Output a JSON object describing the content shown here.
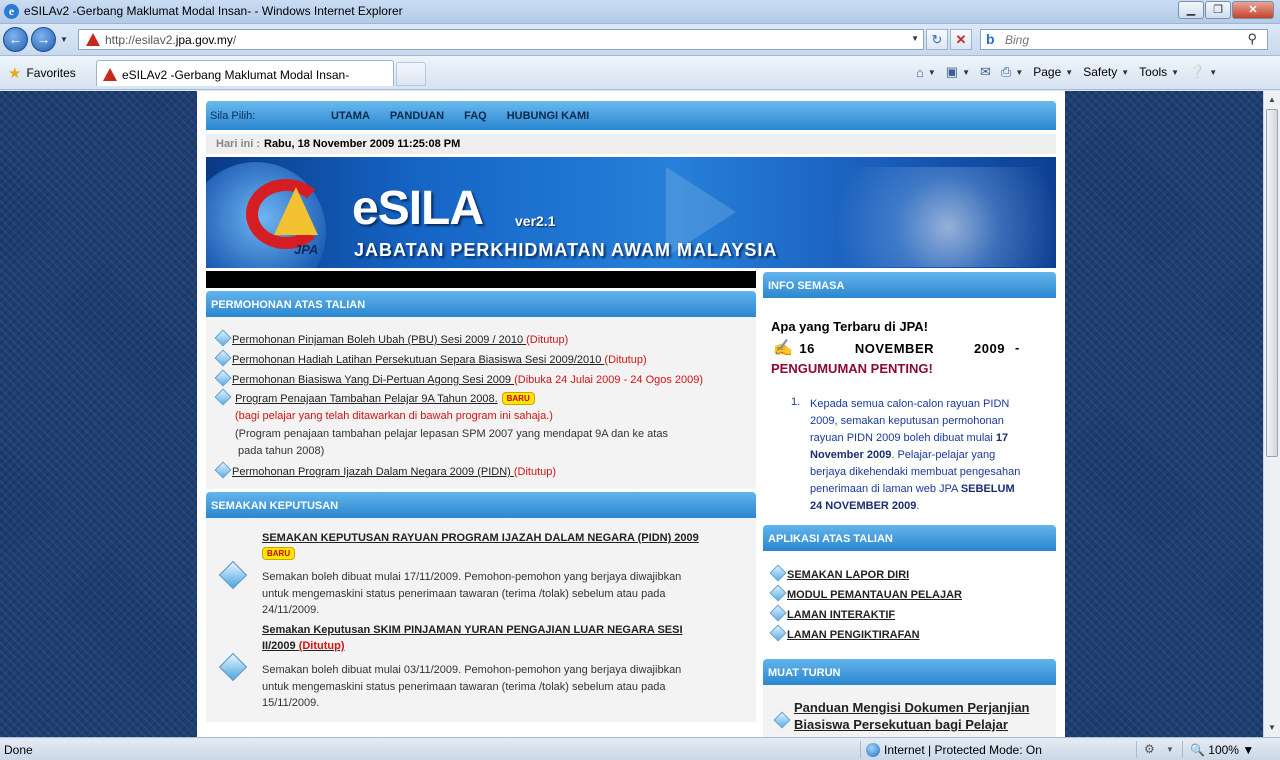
{
  "window": {
    "title": "eSILAv2 -Gerbang Maklumat Modal Insan- - Windows Internet Explorer",
    "minimize": "▁",
    "maximize": "❐",
    "close": "✕"
  },
  "address": {
    "url_prefix": "http://esilav2.",
    "url_domain": "jpa.gov.my",
    "url_suffix": "/",
    "search_placeholder": "Bing"
  },
  "favorites": {
    "label": "Favorites",
    "tab_title": "eSILAv2 -Gerbang Maklumat Modal Insan-",
    "commands": [
      "Page",
      "Safety",
      "Tools"
    ]
  },
  "site": {
    "menu_label": "Sila Pilih:",
    "menu_items": [
      "UTAMA",
      "PANDUAN",
      "FAQ",
      "HUBUNGI KAMI"
    ],
    "today_label": "Hari ini :",
    "today_value": "Rabu, 18 November 2009 11:25:08 PM",
    "banner": {
      "brand": "eSILA",
      "version": "ver2.1",
      "subtitle": "JABATAN PERKHIDMATAN AWAM MALAYSIA",
      "logo_text": "JPA"
    }
  },
  "permohonan": {
    "header": "PERMOHONAN ATAS TALIAN",
    "items": [
      {
        "text": "Permohonan Pinjaman Boleh Ubah (PBU) Sesi 2009 / 2010 ",
        "status": "(Ditutup)"
      },
      {
        "text": "Permohonan Hadiah Latihan Persekutuan Separa Biasiswa Sesi 2009/2010 ",
        "status": "(Ditutup)"
      },
      {
        "text": "Permohonan Biasiswa Yang Di-Pertuan Agong Sesi 2009 ",
        "status": "(Dibuka 24 Julai 2009 - 24 Ogos 2009)"
      },
      {
        "text": "Program Penajaan Tambahan Pelajar 9A Tahun 2008.",
        "badge": "BARU",
        "note_red": "(bagi pelajar yang telah ditawarkan di bawah program ini sahaja.)",
        "note_1": "(Program penajaan tambahan pelajar lepasan SPM 2007 yang mendapat 9A dan ke atas",
        "note_2": "pada tahun 2008)"
      },
      {
        "text": "Permohonan Program Ijazah Dalam Negara 2009 (PIDN) ",
        "status": "(Ditutup)"
      }
    ]
  },
  "semakan": {
    "header": "SEMAKAN KEPUTUSAN",
    "items": [
      {
        "title": "SEMAKAN KEPUTUSAN RAYUAN PROGRAM IJAZAH DALAM NEGARA (PIDN) 2009",
        "badge": "BARU",
        "body": "Semakan boleh dibuat mulai 17/11/2009. Pemohon-pemohon yang berjaya diwajibkan untuk mengemaskini status penerimaan tawaran (terima /tolak) sebelum atau pada 24/11/2009."
      },
      {
        "title_1": "Semakan Keputusan SKIM PINJAMAN YURAN PENGAJIAN LUAR NEGARA SESI",
        "title_2": "II/2009 ",
        "status": "(Ditutup)",
        "body": "Semakan boleh dibuat mulai 03/11/2009. Pemohon-pemohon yang berjaya diwajibkan untuk mengemaskini status penerimaan tawaran (terima /tolak) sebelum atau pada 15/11/2009."
      }
    ]
  },
  "info": {
    "header": "INFO SEMASA",
    "heading": "Apa yang Terbaru di JPA!",
    "date_day": "16",
    "date_month": "NOVEMBER",
    "date_year": "2009",
    "date_dash": "-",
    "announcement": "PENGUMUMAN PENTING!",
    "item_number": "1.",
    "item_part1": "Kepada semua calon-calon rayuan PIDN 2009, semakan keputusan permohonan rayuan PIDN 2009 boleh dibuat mulai ",
    "item_bold1": "17 November 2009",
    "item_part2": ". Pelajar-pelajar yang berjaya dikehendaki membuat pengesahan penerimaan di laman web JPA ",
    "item_bold2": "SEBELUM 24 NOVEMBER 2009",
    "item_part3": "."
  },
  "aplikasi": {
    "header": "APLIKASI ATAS TALIAN",
    "items": [
      "SEMAKAN LAPOR DIRI",
      "MODUL PEMANTAUAN PELAJAR",
      "LAMAN INTERAKTIF",
      "LAMAN PENGIKTIRAFAN"
    ]
  },
  "muat_turun": {
    "header": "MUAT TURUN",
    "item": "Panduan Mengisi Dokumen Perjanjian Biasiswa Persekutuan bagi Pelajar"
  },
  "status": {
    "left": "Done",
    "zone": "Internet | Protected Mode: On",
    "zoom": "100%"
  }
}
